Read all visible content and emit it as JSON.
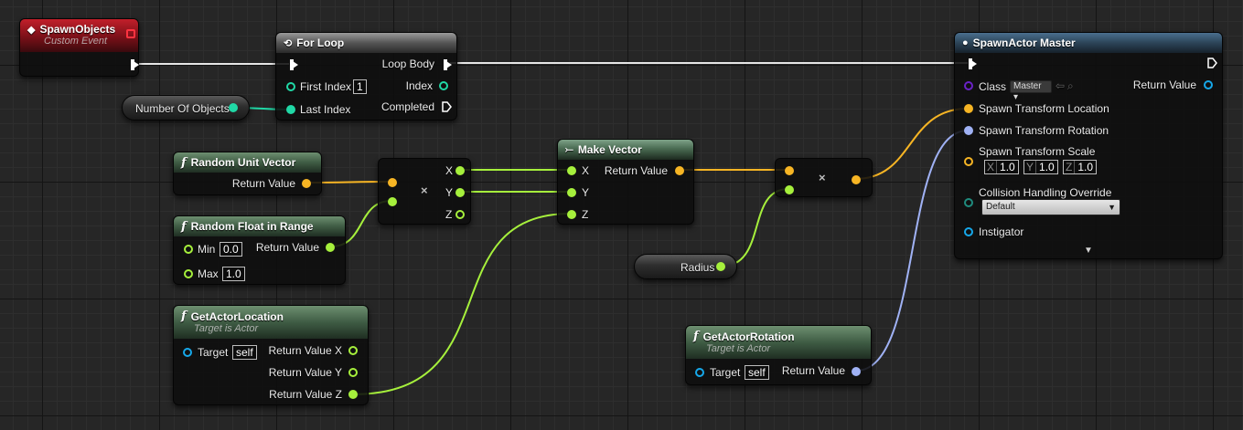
{
  "colors": {
    "exec": "#ffffff",
    "float": "#a6f03c",
    "vector": "#f7b524",
    "int": "#20d8a6",
    "rotator": "#a0b2f5",
    "object": "#16a8ea",
    "class": "#6a22c8"
  },
  "nodes": {
    "spawn_objects": {
      "title": "SpawnObjects",
      "subtitle": "Custom Event"
    },
    "for_loop": {
      "title": "For Loop",
      "first_index_label": "First Index",
      "first_index_value": "1",
      "last_index_label": "Last Index",
      "loop_body_label": "Loop Body",
      "index_label": "Index",
      "completed_label": "Completed"
    },
    "number_of_objects": {
      "label": "Number Of Objects"
    },
    "random_unit_vector": {
      "title": "Random Unit Vector",
      "return_label": "Return Value"
    },
    "random_float": {
      "title": "Random Float in Range",
      "min_label": "Min",
      "min_value": "0.0",
      "max_label": "Max",
      "max_value": "1.0",
      "return_label": "Return Value"
    },
    "multiply_1": {
      "symbol": "×",
      "x_label": "X",
      "y_label": "Y",
      "z_label": "Z"
    },
    "make_vector": {
      "title": "Make Vector",
      "x_label": "X",
      "y_label": "Y",
      "z_label": "Z",
      "return_label": "Return Value"
    },
    "multiply_2": {
      "symbol": "×"
    },
    "radius": {
      "label": "Radius"
    },
    "get_actor_location": {
      "title": "GetActorLocation",
      "subtitle": "Target is Actor",
      "target_label": "Target",
      "target_value": "self",
      "rx_label": "Return Value X",
      "ry_label": "Return Value Y",
      "rz_label": "Return Value Z"
    },
    "get_actor_rotation": {
      "title": "GetActorRotation",
      "subtitle": "Target is Actor",
      "target_label": "Target",
      "target_value": "self",
      "return_label": "Return Value"
    },
    "spawn_actor": {
      "title": "SpawnActor Master",
      "class_label": "Class",
      "class_value": "Master",
      "return_label": "Return Value",
      "location_label": "Spawn Transform Location",
      "rotation_label": "Spawn Transform Rotation",
      "scale_label": "Spawn Transform Scale",
      "scale": {
        "x_axis": "X",
        "x": "1.0",
        "y_axis": "Y",
        "y": "1.0",
        "z_axis": "Z",
        "z": "1.0"
      },
      "collision_label": "Collision Handling Override",
      "collision_value": "Default",
      "instigator_label": "Instigator",
      "expand_icon": "chevron-down-icon"
    }
  }
}
